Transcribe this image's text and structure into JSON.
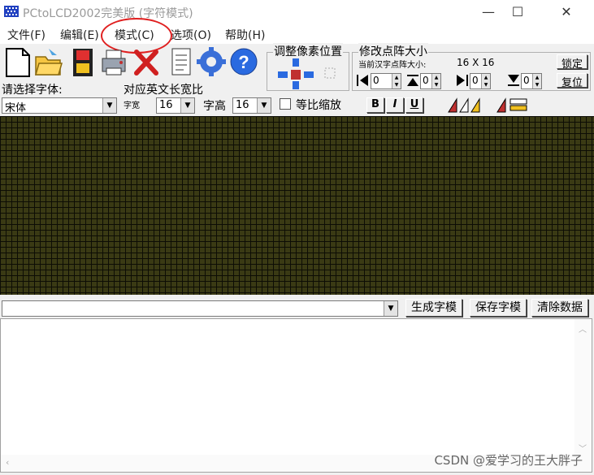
{
  "window": {
    "title": "PCtoLCD2002完美版 (字符模式)",
    "minimize": "—",
    "maximize": "☐",
    "close": "✕"
  },
  "menu": {
    "items": [
      "文件(F)",
      "编辑(E)",
      "模式(C)",
      "选项(O)",
      "帮助(H)"
    ]
  },
  "toolbar": {
    "icons": [
      "new-file-icon",
      "open-folder-icon",
      "save-disk-icon",
      "printer-icon",
      "delete-x-icon",
      "notes-icon",
      "gear-icon",
      "help-icon"
    ]
  },
  "pixel_adjust": {
    "label": "调整像素位置"
  },
  "matrix_size": {
    "label": "修改点阵大小",
    "current_label": "当前汉字点阵大小:",
    "current_value": "16 X 16",
    "lock_label": "锁定",
    "reset_label": "复位",
    "spinners": [
      "0",
      "0",
      "0",
      "0"
    ]
  },
  "font": {
    "select_label": "请选择字体:",
    "font_name": "宋体",
    "ratio_label": "对应英文长宽比",
    "width_label": "字宽",
    "width_value": "16",
    "height_label": "字高",
    "height_value": "16",
    "proportional_label": "等比缩放",
    "bold": "B",
    "italic": "I",
    "underline": "U"
  },
  "actions": {
    "input_value": "",
    "generate_label": "生成字模",
    "save_label": "保存字模",
    "clear_label": "清除数据"
  },
  "watermark": "CSDN @爱学习的王大胖子",
  "colors": {
    "grid_bg": "#3a3a14",
    "grid_line": "#0d0d05",
    "annotation": "#e02020"
  }
}
